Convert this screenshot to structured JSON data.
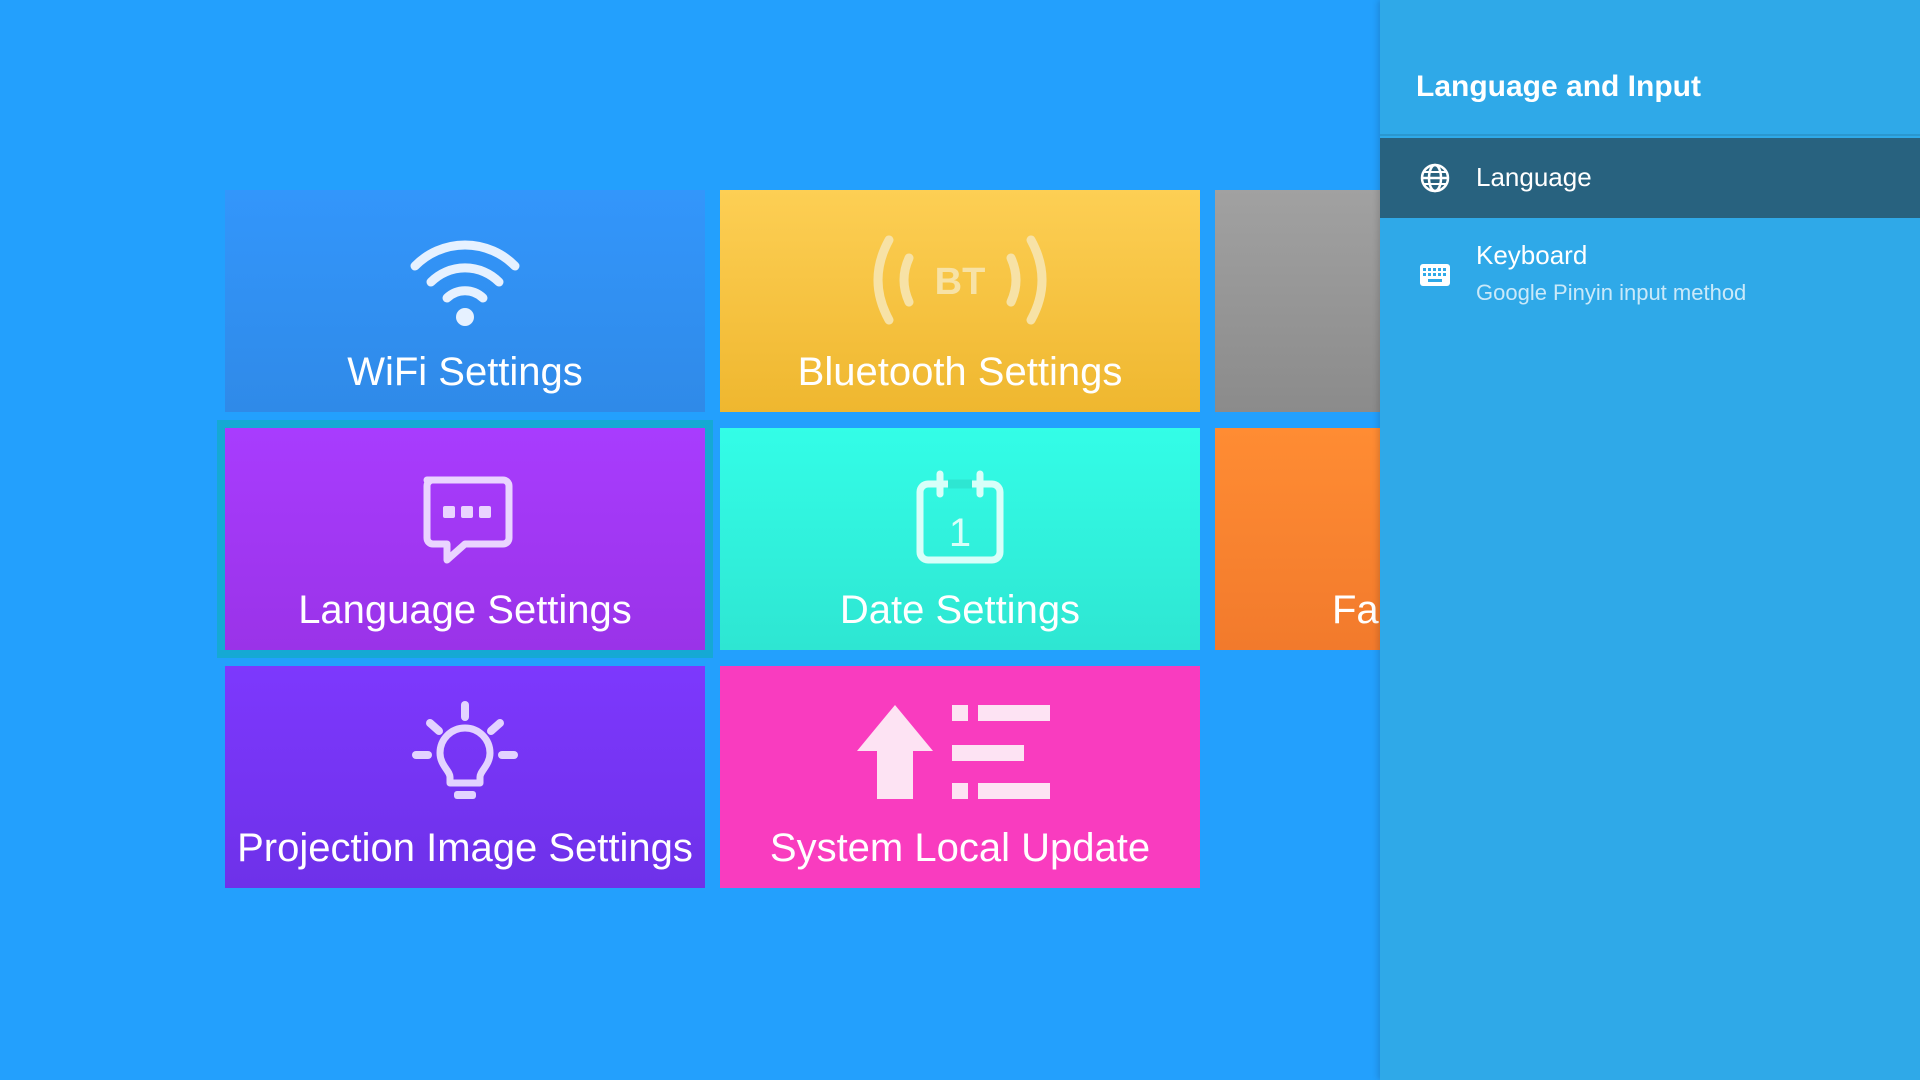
{
  "tiles": {
    "wifi": "WiFi Settings",
    "bluetooth": "Bluetooth Settings",
    "language": "Language Settings",
    "date": "Date Settings",
    "factory": "Fa",
    "projection": "Projection Image Settings",
    "update": "System Local Update"
  },
  "icons": {
    "bluetooth_text": "BT",
    "date_number": "1"
  },
  "panel": {
    "title": "Language and Input",
    "items": [
      {
        "label": "Language",
        "icon": "globe-icon",
        "selected": true
      },
      {
        "label": "Keyboard",
        "sub": "Google Pinyin input method",
        "icon": "keyboard-icon"
      }
    ]
  },
  "colors": {
    "background": "#23a0fd",
    "panel": "#2fa9e8",
    "selected_item": "#28627f",
    "focus_outline": "#15a9d4"
  }
}
